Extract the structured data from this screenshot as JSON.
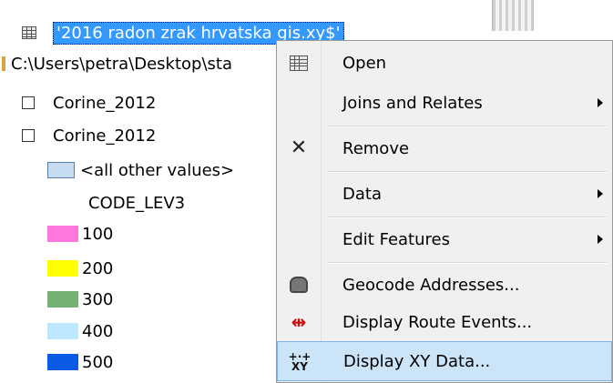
{
  "toc": {
    "selected_layer": "'2016 radon zrak hrvatska gis.xy$'",
    "source_path": "C:\\Users\\petra\\Desktop\\sta",
    "layers": [
      "Corine_2012",
      "Corine_2012"
    ],
    "all_other_values": "<all other values>",
    "field_name": "CODE_LEV3",
    "legend": [
      {
        "label": "100",
        "color": "#ff77dd"
      },
      {
        "label": "200",
        "color": "#ffff00"
      },
      {
        "label": "300",
        "color": "#73b273"
      },
      {
        "label": "400",
        "color": "#bee8ff"
      },
      {
        "label": "500",
        "color": "#0a5ce6"
      }
    ],
    "other_values_color": "#c5dcf0"
  },
  "menu": {
    "items": [
      {
        "label": "Open",
        "icon": "table-icon",
        "submenu": false
      },
      {
        "label": "Joins and Relates",
        "icon": "",
        "submenu": true
      },
      {
        "label": "Remove",
        "icon": "remove-x-icon",
        "submenu": false
      },
      {
        "label": "Data",
        "icon": "",
        "submenu": true
      },
      {
        "label": "Edit Features",
        "icon": "",
        "submenu": true
      },
      {
        "label": "Geocode Addresses...",
        "icon": "geocode-icon",
        "submenu": false
      },
      {
        "label": "Display Route Events...",
        "icon": "route-events-icon",
        "submenu": false
      },
      {
        "label": "Display XY Data...",
        "icon": "xy-data-icon",
        "submenu": false,
        "highlighted": true
      }
    ]
  },
  "colors": {
    "selection": "#3399ff",
    "menu_bg": "#f0f0f0",
    "menu_hover": "#cce4f7"
  }
}
